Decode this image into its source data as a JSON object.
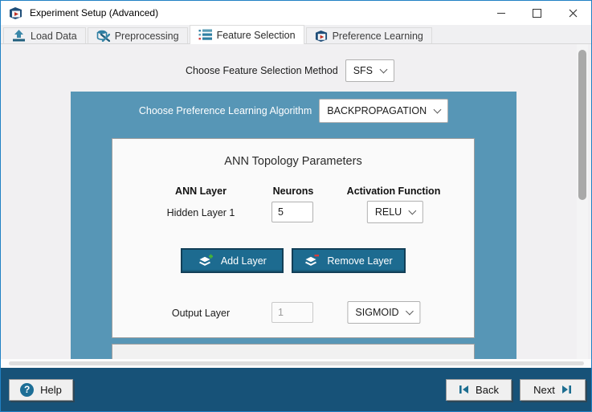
{
  "window": {
    "title": "Experiment Setup (Advanced)"
  },
  "tabs": {
    "items": [
      {
        "label": "Load Data",
        "icon": "upload-icon",
        "active": false
      },
      {
        "label": "Preprocessing",
        "icon": "tools-icon",
        "active": false
      },
      {
        "label": "Feature Selection",
        "icon": "list-icon",
        "active": true
      },
      {
        "label": "Preference Learning",
        "icon": "cube-icon",
        "active": false
      }
    ]
  },
  "main": {
    "feature_method_label": "Choose Feature Selection Method",
    "feature_method_value": "SFS",
    "algorithm_label": "Choose Preference Learning Algorithm",
    "algorithm_value": "BACKPROPAGATION",
    "ann": {
      "title": "ANN Topology Parameters",
      "col_layer": "ANN Layer",
      "col_neurons": "Neurons",
      "col_activation": "Activation Function",
      "hidden_row": {
        "label": "Hidden Layer 1",
        "neurons": "5",
        "activation": "RELU"
      },
      "add_button": "Add Layer",
      "remove_button": "Remove Layer",
      "output_row": {
        "label": "Output Layer",
        "neurons": "1",
        "activation": "SIGMOID"
      }
    }
  },
  "footer": {
    "help": "Help",
    "back": "Back",
    "next": "Next"
  },
  "colors": {
    "panel_teal": "#5796b6",
    "footer_bg": "#175278",
    "action_button_bg": "#1d6b90",
    "action_button_border": "#123f57",
    "accent_icon_blue": "#1d6e96",
    "tab_icon_teal": "#2f7fa3",
    "add_plus_green": "#46b535",
    "remove_minus_red": "#d53c3c",
    "window_border_blue": "#2181c4"
  }
}
